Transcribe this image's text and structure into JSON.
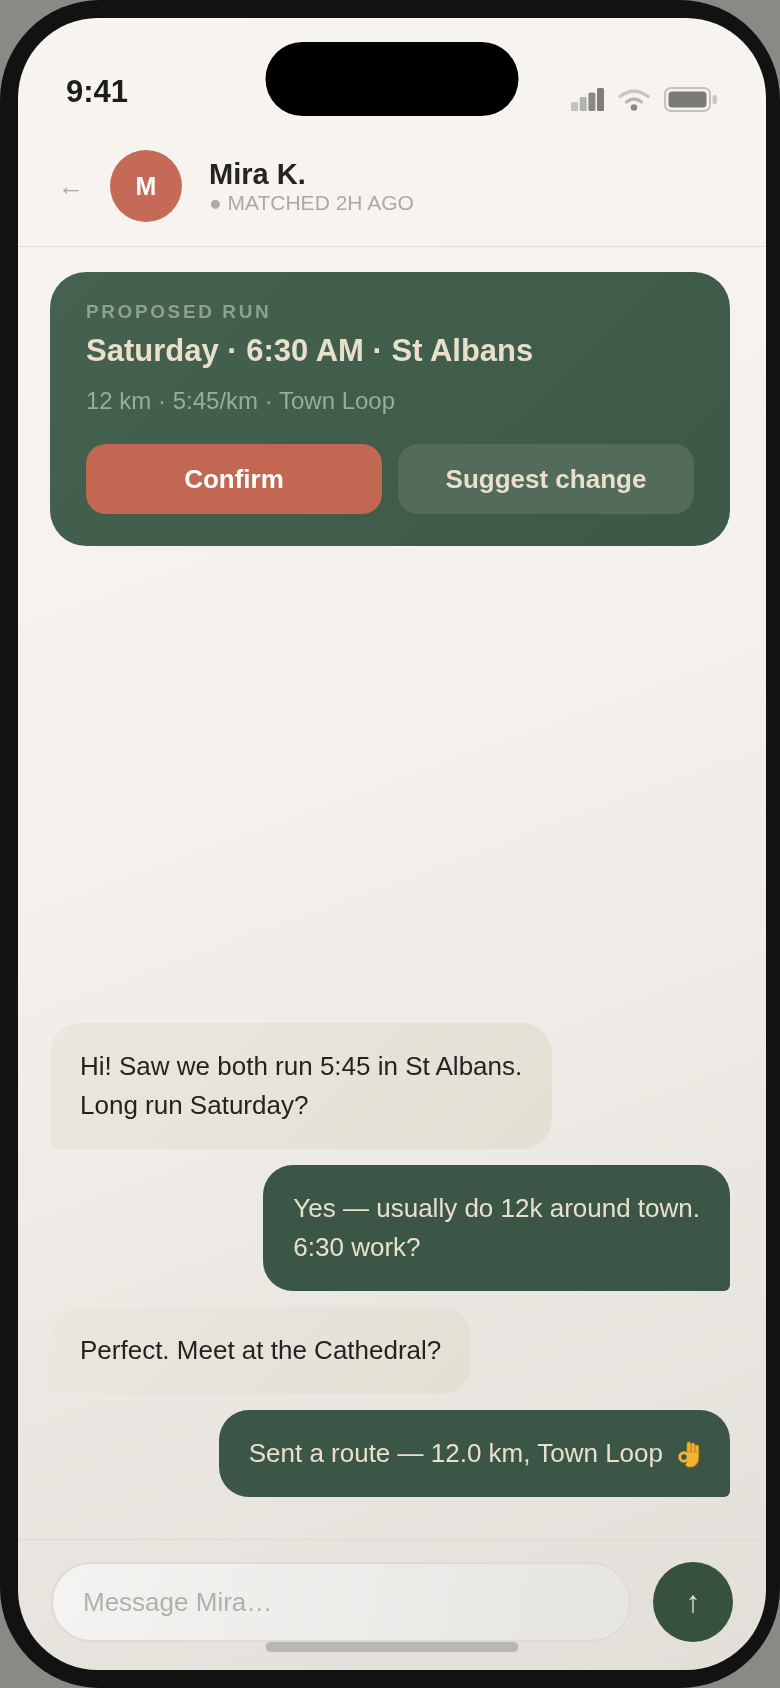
{
  "status_bar": {
    "time": "9:41"
  },
  "header": {
    "back": "←",
    "avatar_initial": "M",
    "name": "Mira K.",
    "subtitle": "● MATCHED 2H AGO"
  },
  "proposal_card": {
    "label": "PROPOSED RUN",
    "title": "Saturday · 6:30 AM · St Albans",
    "details": "12 km · 5:45/km · Town Loop",
    "buttons": [
      {
        "label": "Confirm",
        "kind": "primary"
      },
      {
        "label": "Suggest change",
        "kind": "secondary"
      }
    ]
  },
  "messages": [
    {
      "kind": "received",
      "text": "Hi! Saw we both run 5:45 in St Albans.\nLong run Saturday?",
      "emoji": false
    },
    {
      "kind": "sent",
      "text": "Yes — usually do 12k around town.\n6:30 work?",
      "emoji": false
    },
    {
      "kind": "received",
      "text": "Perfect. Meet at the Cathedral?",
      "emoji": false
    },
    {
      "kind": "sent",
      "text": "Sent a route — 12.0 km, Town Loop",
      "emoji": true
    }
  ],
  "composer": {
    "placeholder": "Message Mira…",
    "send": "↑"
  }
}
